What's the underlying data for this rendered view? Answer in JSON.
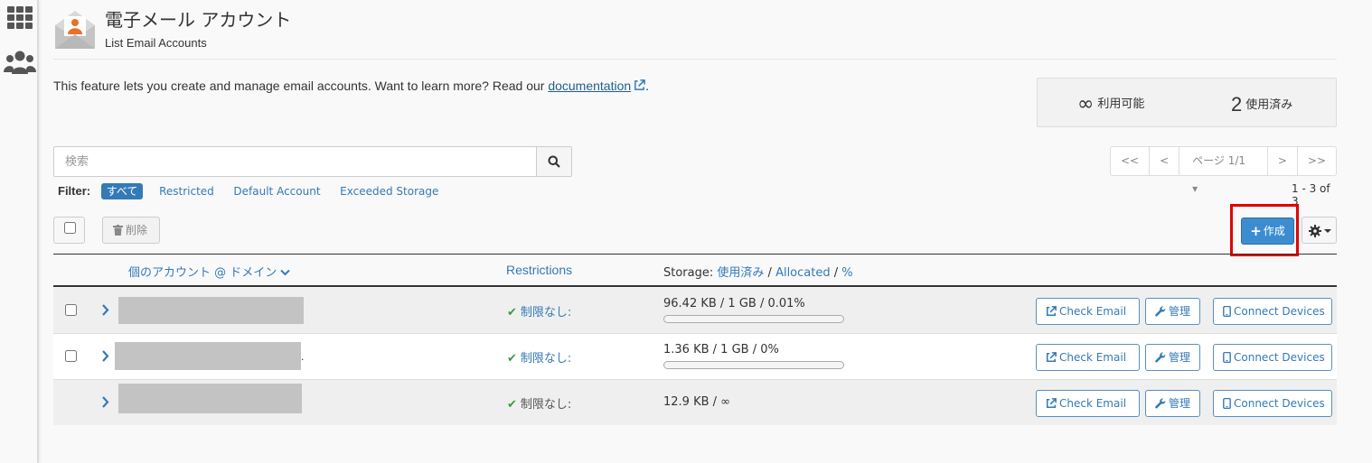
{
  "header": {
    "title": "電子メール アカウント",
    "subtitle": "List Email Accounts"
  },
  "intro": {
    "text": "This feature lets you create and manage email accounts. Want to learn more? Read our ",
    "link": "documentation",
    "after": "."
  },
  "stats": {
    "available_value": "∞",
    "available_label": "利用可能",
    "used_value": "2",
    "used_label": "使用済み"
  },
  "search": {
    "placeholder": "検索"
  },
  "filter": {
    "label": "Filter:",
    "options": [
      "すべて",
      "Restricted",
      "Default Account",
      "Exceeded Storage"
    ]
  },
  "pager": {
    "first": "<<",
    "prev": "<",
    "page": "ページ 1/1 ▾",
    "next": ">",
    "last": ">>",
    "count": "1 - 3 of 3"
  },
  "toolbar": {
    "delete_label": "削除",
    "create_label": "作成"
  },
  "table": {
    "col_account": "個のアカウント @ ドメイン",
    "col_restrictions": "Restrictions",
    "col_storage_prefix": "Storage: ",
    "col_storage_used": "使用済み",
    "col_storage_sep1": " / ",
    "col_storage_alloc": "Allocated",
    "col_storage_sep2": " / ",
    "col_storage_pct": "%",
    "rows": [
      {
        "restriction": "制限なし:",
        "storage": "96.42 KB / 1 GB / 0.01%",
        "usage_fraction": 0.0001
      },
      {
        "restriction": "制限なし:",
        "storage": "1.36 KB / 1 GB / 0%",
        "usage_fraction": 0.0
      },
      {
        "restriction": "制限なし:",
        "storage": "12.9 KB / ∞"
      }
    ],
    "row2_trailing": ".",
    "btn_check_email": "Check Email",
    "btn_manage": "管理",
    "btn_connect": "Connect Devices"
  },
  "colors": {
    "accent": "#337ab7",
    "primary_button": "#3c8dd0",
    "highlight_box": "#e00000",
    "check_green": "#3c9a3c"
  }
}
